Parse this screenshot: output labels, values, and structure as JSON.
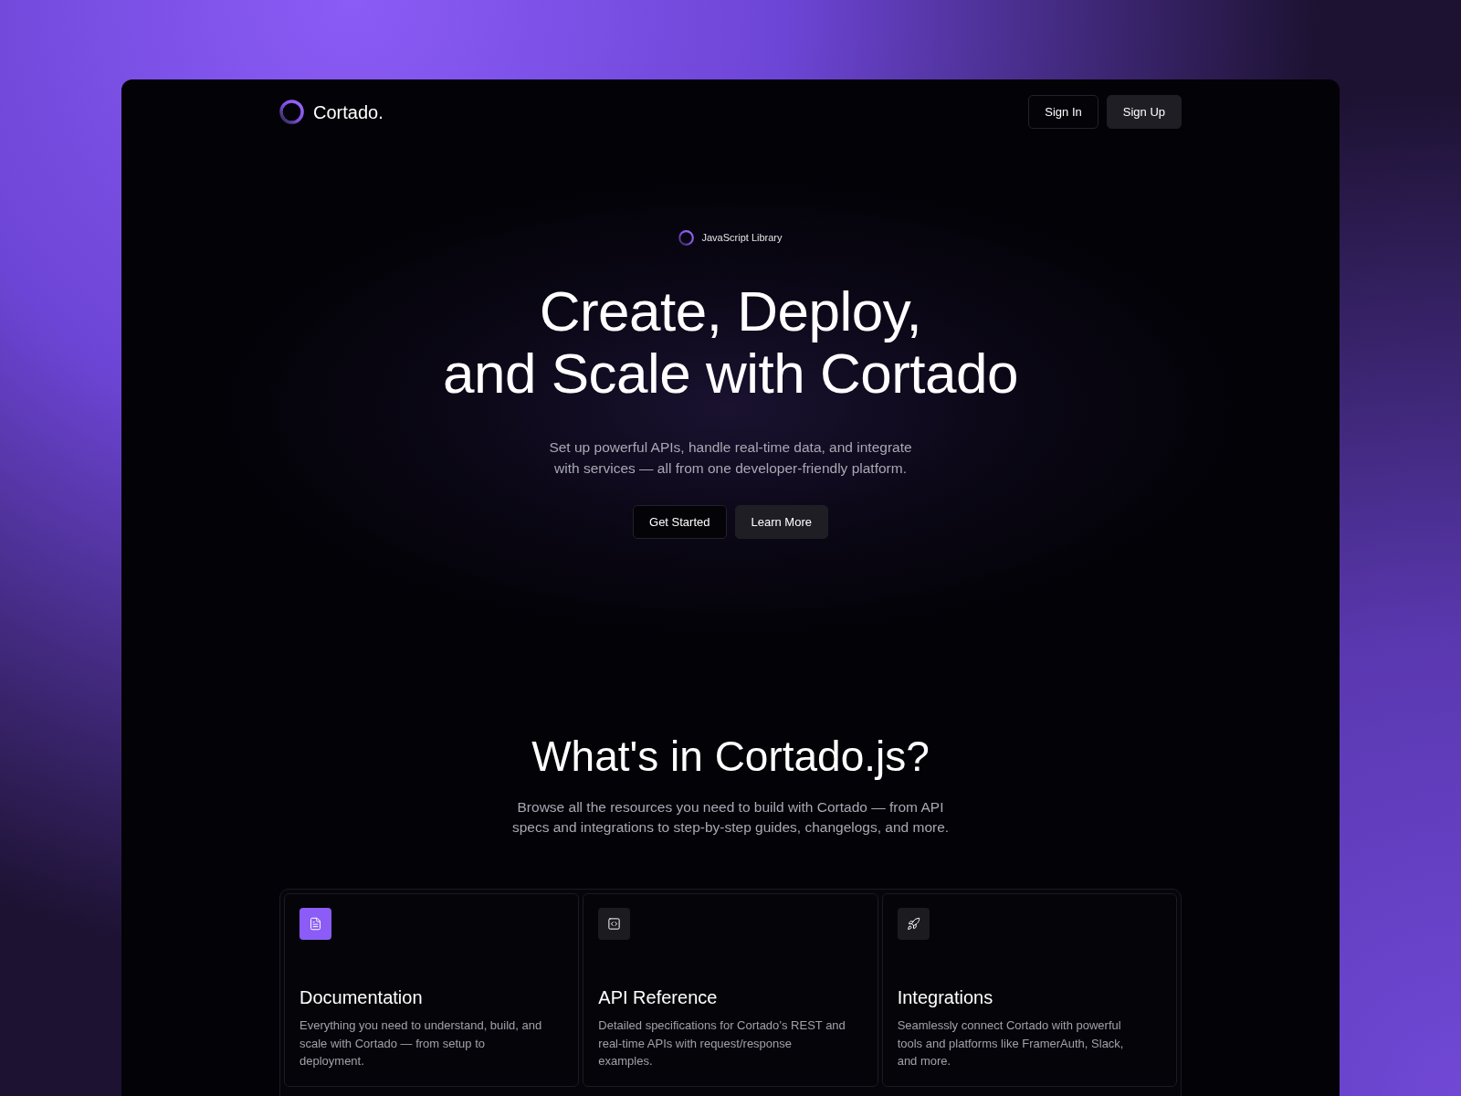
{
  "nav": {
    "brand": "Cortado.",
    "buttons": [
      {
        "label": "Sign In",
        "kind": "outline"
      },
      {
        "label": "Sign Up",
        "kind": "filled"
      }
    ]
  },
  "hero": {
    "badge": "JavaScript Library",
    "title_lines": [
      "Create, Deploy,",
      "and Scale with Cortado"
    ],
    "subtitle_lines": [
      "Set up powerful APIs, handle real-time data, and integrate",
      "with services — all from one developer-friendly platform."
    ],
    "buttons": [
      {
        "label": "Get Started",
        "kind": "outline"
      },
      {
        "label": "Learn More",
        "kind": "filled"
      }
    ]
  },
  "features": {
    "title": "What's in Cortado.js?",
    "subtitle_lines": [
      "Browse all the resources you need to build with Cortado — from API",
      "specs and integrations to step-by-step guides, changelogs, and more."
    ],
    "cards": [
      {
        "title": "Documentation",
        "description_lines": [
          "Everything you need to understand, build, and",
          "scale with Cortado — from setup to",
          "deployment."
        ],
        "highlighted": true
      },
      {
        "title": "API Reference",
        "description_lines": [
          "Detailed specifications for Cortado’s REST and",
          "real-time APIs with request/response",
          "examples."
        ],
        "highlighted": false
      },
      {
        "title": "Integrations",
        "description_lines": [
          "Seamlessly connect Cortado with powerful",
          "tools and platforms like FramerAuth, Slack,",
          "and more."
        ],
        "highlighted": false
      }
    ]
  }
}
